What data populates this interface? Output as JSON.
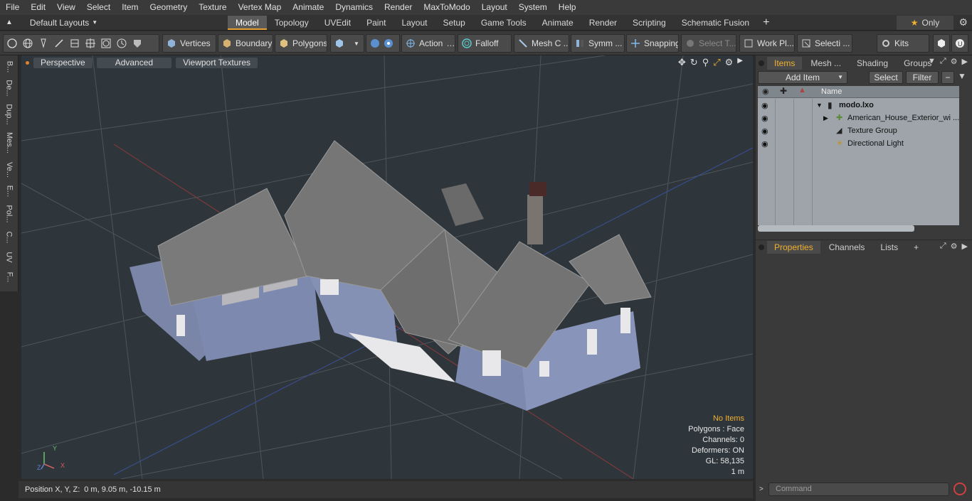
{
  "menu": [
    "File",
    "Edit",
    "View",
    "Select",
    "Item",
    "Geometry",
    "Texture",
    "Vertex Map",
    "Animate",
    "Dynamics",
    "Render",
    "MaxToModo",
    "Layout",
    "System",
    "Help"
  ],
  "layout_selector": "Default Layouts",
  "tabs": [
    "Model",
    "Topology",
    "UVEdit",
    "Paint",
    "Layout",
    "Setup",
    "Game Tools",
    "Animate",
    "Render",
    "Scripting",
    "Schematic Fusion"
  ],
  "active_tab": "Model",
  "only_label": "Only",
  "toolbar": {
    "vertices": "Vertices",
    "boundary": "Boundary",
    "polygons": "Polygons",
    "action": "Action",
    "falloff": "Falloff",
    "mesh": "Mesh C ...",
    "symmetry": "Symm ...",
    "snapping": "Snapping",
    "select_t": "Select T...",
    "work_plane": "Work Pl...",
    "selection": "Selecti ...",
    "kits": "Kits"
  },
  "left_tabs": [
    "B...",
    "De...",
    "Dup...",
    "Mes...",
    "Ve...",
    "E...",
    "Pol...",
    "C...",
    "UV",
    "F..."
  ],
  "viewport": {
    "buttons": [
      "Perspective",
      "Advanced",
      "Viewport Textures"
    ],
    "stats": {
      "no_items": "No Items",
      "polygons": "Polygons : Face",
      "channels": "Channels: 0",
      "deformers": "Deformers: ON",
      "gl": "GL: 58,135",
      "scale": "1 m"
    },
    "axis_labels": {
      "y": "Y",
      "x": "X",
      "z": "Z"
    }
  },
  "statusbar": {
    "label": "Position X, Y, Z:",
    "value": "0 m, 9.05 m, -10.15 m"
  },
  "right_panel": {
    "top_tabs": [
      "Items",
      "Mesh ...",
      "Shading",
      "Groups"
    ],
    "add_item": "Add Item",
    "select": "Select",
    "filter": "Filter",
    "name_header": "Name",
    "items": [
      {
        "name": "modo.lxo",
        "bold": true
      },
      {
        "name": "American_House_Exterior_wi ...",
        "bold": false
      },
      {
        "name": "Texture Group",
        "bold": false
      },
      {
        "name": "Directional Light",
        "bold": false
      }
    ],
    "bottom_tabs": [
      "Properties",
      "Channels",
      "Lists"
    ],
    "command_placeholder": "Command"
  },
  "colors": {
    "accent": "#f0b030",
    "viewport_bg": "#2f363b",
    "list_bg": "#9ea4aa"
  }
}
